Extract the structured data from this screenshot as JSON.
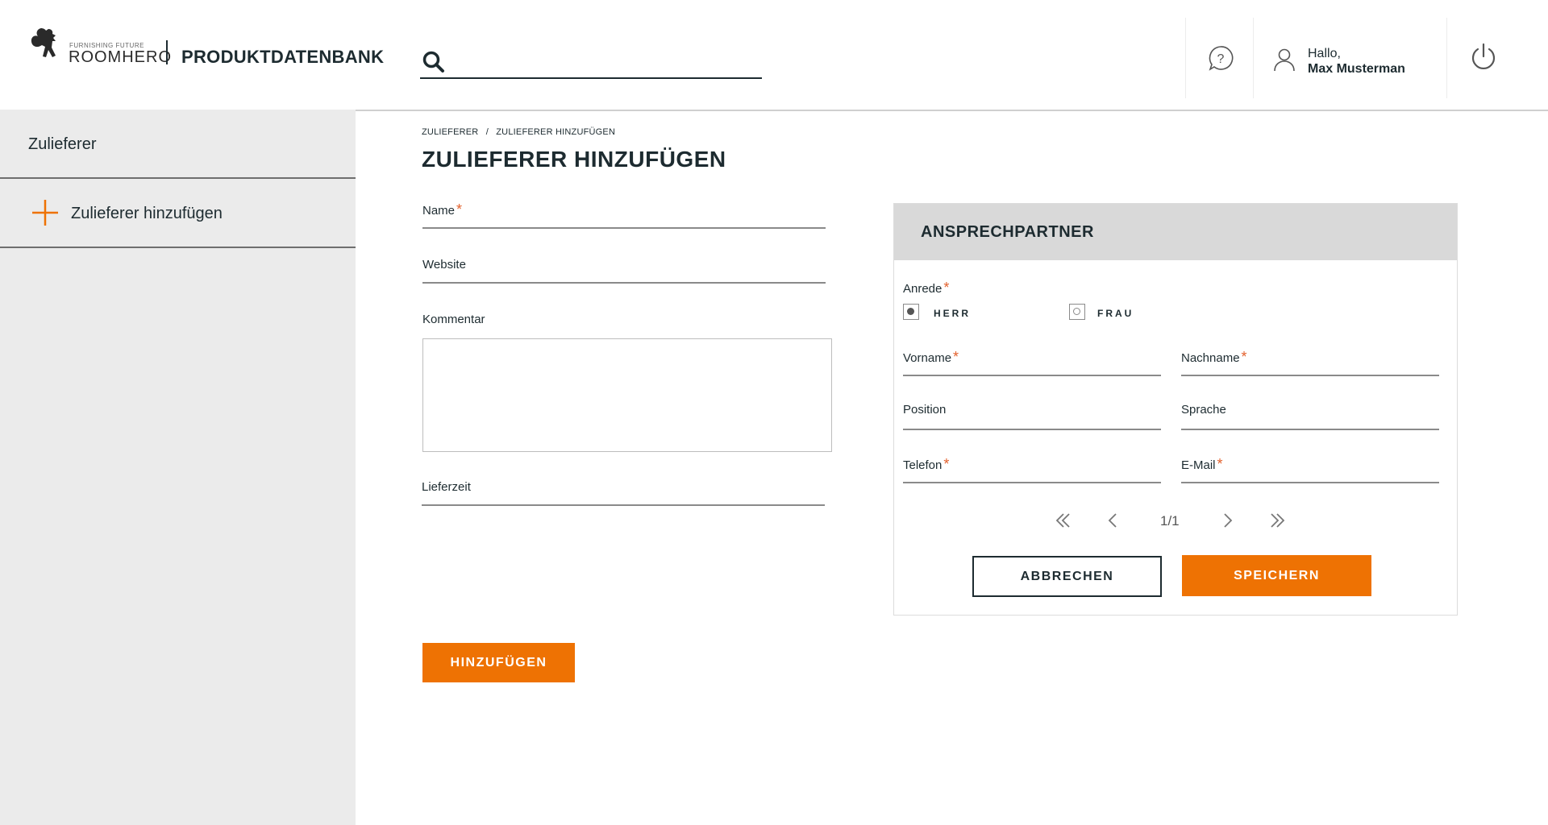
{
  "header": {
    "logo_tagline": "FURNISHING FUTURE",
    "logo_word": "ROOMHERO",
    "product_title": "PRODUKTDATENBANK",
    "search_placeholder": "",
    "greeting": "Hallo,",
    "username": "Max Musterman"
  },
  "sidebar": {
    "items": [
      {
        "label": "Zulieferer"
      },
      {
        "label": "Zulieferer hinzufügen",
        "icon": "plus-icon"
      }
    ]
  },
  "breadcrumb": {
    "items": [
      "ZULIEFERER",
      "ZULIEFERER HINZUFÜGEN"
    ],
    "separator": "/"
  },
  "page_title": "ZULIEFERER HINZUFÜGEN",
  "form": {
    "name_label": "Name",
    "website_label": "Website",
    "kommentar_label": "Kommentar",
    "lieferzeit_label": "Lieferzeit",
    "submit_label": "HINZUFÜGEN",
    "required_mark": "*"
  },
  "contact": {
    "title": "ANSPRECHPARTNER",
    "anrede_label": "Anrede",
    "anrede_options": [
      "HERR",
      "FRAU"
    ],
    "anrede_selected": "HERR",
    "vorname_label": "Vorname",
    "nachname_label": "Nachname",
    "position_label": "Position",
    "sprache_label": "Sprache",
    "telefon_label": "Telefon",
    "email_label": "E-Mail",
    "pager_text": "1/1",
    "cancel_label": "ABBRECHEN",
    "save_label": "SPEICHERN"
  },
  "colors": {
    "accent": "#ee7203",
    "text_dark": "#1d2b30",
    "sidebar_bg": "#ebebeb",
    "panel_head_bg": "#d9d9d9"
  }
}
